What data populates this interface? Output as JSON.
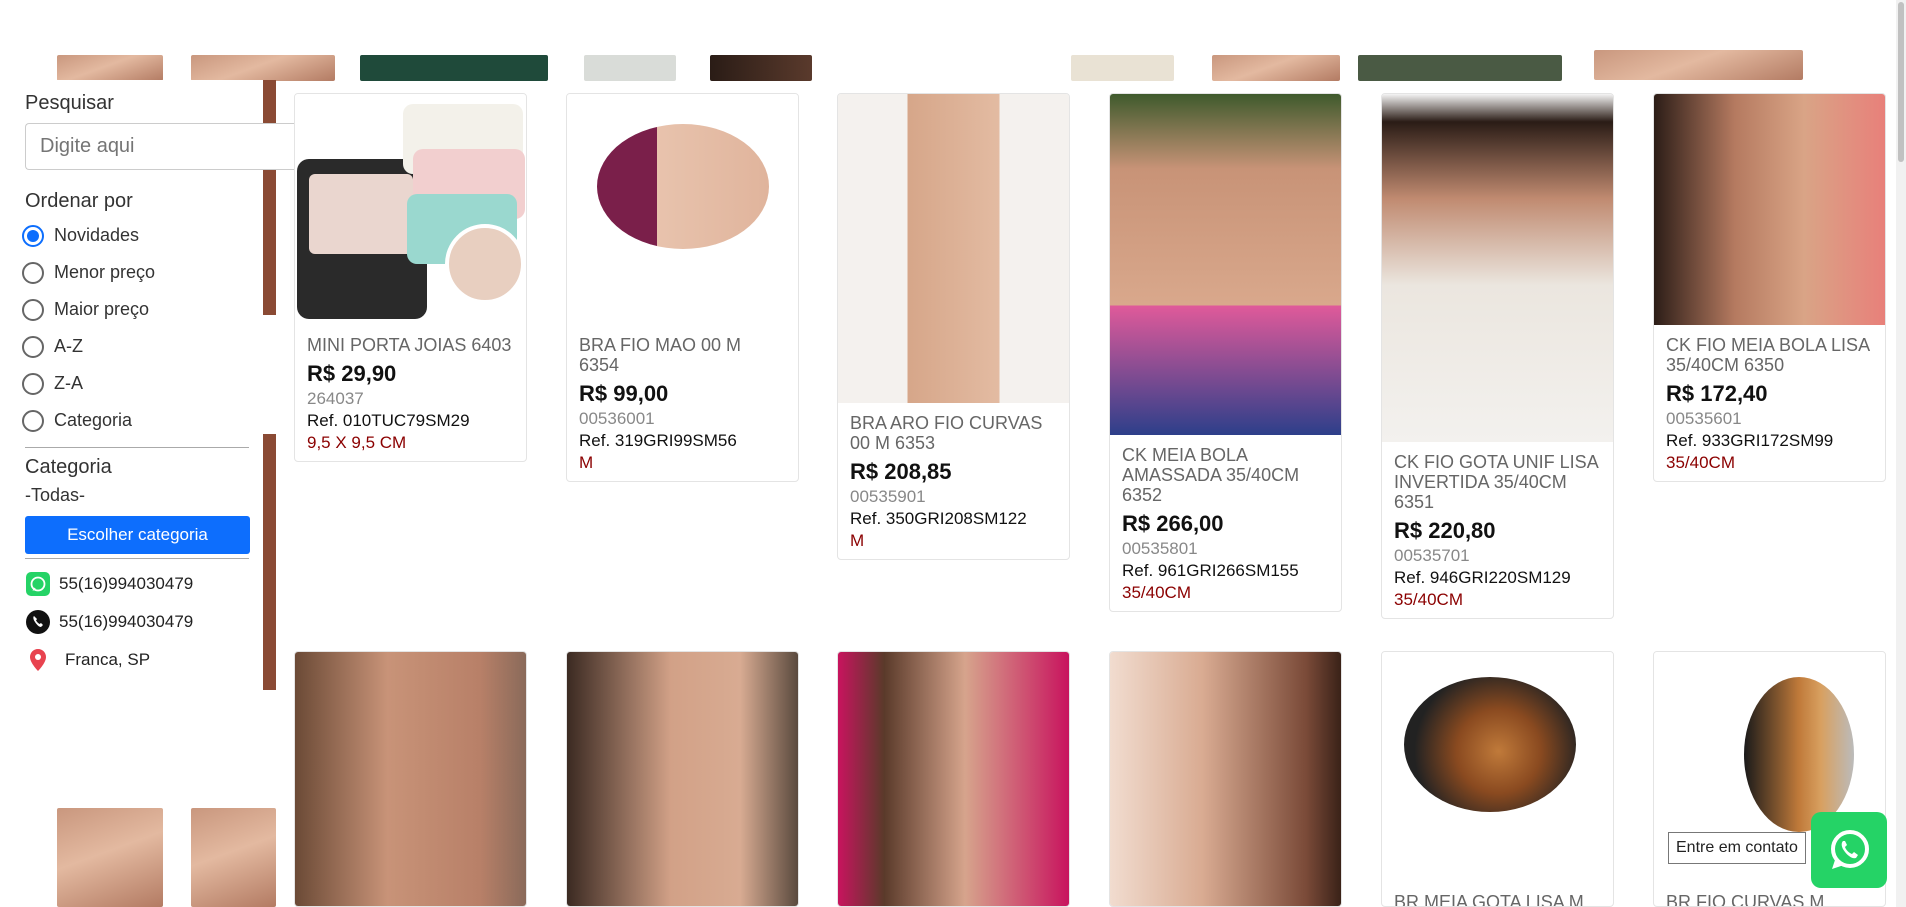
{
  "sidebar": {
    "search_title": "Pesquisar",
    "search_placeholder": "Digite aqui",
    "sort_title": "Ordenar por",
    "sort_options": [
      {
        "label": "Novidades",
        "selected": true
      },
      {
        "label": "Menor preço",
        "selected": false
      },
      {
        "label": "Maior preço",
        "selected": false
      },
      {
        "label": "A-Z",
        "selected": false
      },
      {
        "label": "Z-A",
        "selected": false
      },
      {
        "label": "Categoria",
        "selected": false
      }
    ],
    "category_title": "Categoria",
    "category_value": "-Todas-",
    "category_button": "Escolher categoria",
    "whatsapp_phone": "55(16)994030479",
    "phone": "55(16)994030479",
    "location": "Franca, SP"
  },
  "products": [
    {
      "name": "MINI PORTA JOIAS 6403",
      "price": "R$ 29,90",
      "code": "264037",
      "ref": "Ref. 010TUC79SM29",
      "size": "9,5 X 9,5 CM"
    },
    {
      "name": "BRA FIO MAO 00 M 6354",
      "price": "R$ 99,00",
      "code": "00536001",
      "ref": "Ref. 319GRI99SM56",
      "size": "M"
    },
    {
      "name": "BRA ARO FIO CURVAS 00 M 6353",
      "price": "R$ 208,85",
      "code": "00535901",
      "ref": "Ref. 350GRI208SM122",
      "size": "M"
    },
    {
      "name": "CK MEIA BOLA AMASSADA 35/40CM 6352",
      "price": "R$ 266,00",
      "code": "00535801",
      "ref": "Ref. 961GRI266SM155",
      "size": "35/40CM"
    },
    {
      "name": "CK FIO GOTA UNIF LISA INVERTIDA 35/40CM 6351",
      "price": "R$ 220,80",
      "code": "00535701",
      "ref": "Ref. 946GRI220SM129",
      "size": "35/40CM"
    },
    {
      "name": "CK FIO MEIA BOLA LISA 35/40CM 6350",
      "price": "R$ 172,40",
      "code": "00535601",
      "ref": "Ref. 933GRI172SM99",
      "size": "35/40CM"
    }
  ],
  "partial_products": [
    {
      "name": "BR MEIA GOTA LISA M"
    },
    {
      "name": "BR FIO CURVAS M"
    }
  ],
  "contact_tag": "Entre em contato",
  "icons": [
    "search-icon",
    "whatsapp-icon",
    "phone-icon",
    "location-pin-icon"
  ],
  "colors": {
    "accent": "#0d6efd",
    "size_text": "#8b0000",
    "whatsapp": "#25d366"
  }
}
